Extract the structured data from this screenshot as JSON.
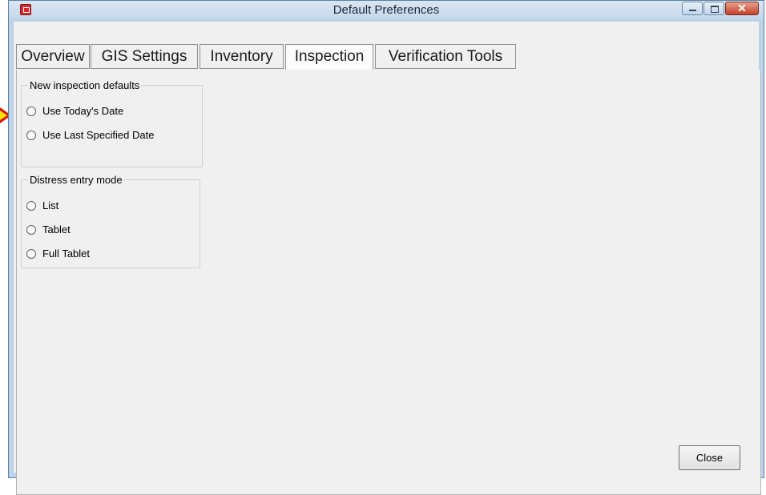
{
  "window": {
    "title": "Default Preferences",
    "close_glyph": "✕"
  },
  "tabs": [
    {
      "label": "Overview",
      "active": false
    },
    {
      "label": "GIS Settings",
      "active": false
    },
    {
      "label": "Inventory",
      "active": false
    },
    {
      "label": "Inspection",
      "active": true
    },
    {
      "label": "Verification Tools",
      "active": false
    }
  ],
  "inspection": {
    "new_defaults": {
      "title": "New inspection defaults",
      "options": [
        {
          "label": "Use Today's Date",
          "checked": false
        },
        {
          "label": "Use Last Specified Date",
          "checked": false
        }
      ]
    },
    "distress_mode": {
      "title": "Distress entry mode",
      "options": [
        {
          "label": "List",
          "checked": false
        },
        {
          "label": "Tablet",
          "checked": false
        },
        {
          "label": "Full Tablet",
          "checked": false
        }
      ]
    }
  },
  "buttons": {
    "close": "Close"
  },
  "icons": {
    "app": "app-icon",
    "minimize": "minimize-icon",
    "maximize": "maximize-icon",
    "close": "close-icon",
    "pointer": "arrow-pointer-icon"
  },
  "colors": {
    "titlebar": "#c5d8ec",
    "client": "#f0f0f0",
    "close_button": "#c4412a",
    "pointer_fill": "#ffe000",
    "pointer_outline": "#d01a00"
  }
}
